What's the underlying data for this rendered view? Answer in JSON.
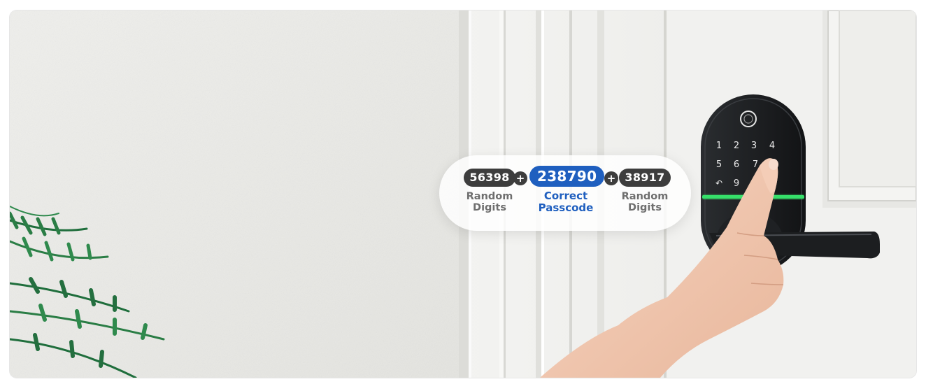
{
  "passcode_demo": {
    "left": {
      "digits": "56398",
      "caption_line1": "Random",
      "caption_line2": "Digits"
    },
    "middle": {
      "digits": "238790",
      "caption_line1": "Correct",
      "caption_line2": "Passcode"
    },
    "right": {
      "digits": "38917",
      "caption_line1": "Random",
      "caption_line2": "Digits"
    },
    "operator": "+"
  },
  "keypad": {
    "row1": [
      "1",
      "2",
      "3",
      "4"
    ],
    "row2": [
      "5",
      "6",
      "7"
    ],
    "row3": [
      "9"
    ]
  },
  "colors": {
    "accent_blue": "#1f5fbf",
    "badge_dark": "#3d3d3d",
    "indicator_green": "#36e06a",
    "lock_body": "#1b1d1f"
  }
}
